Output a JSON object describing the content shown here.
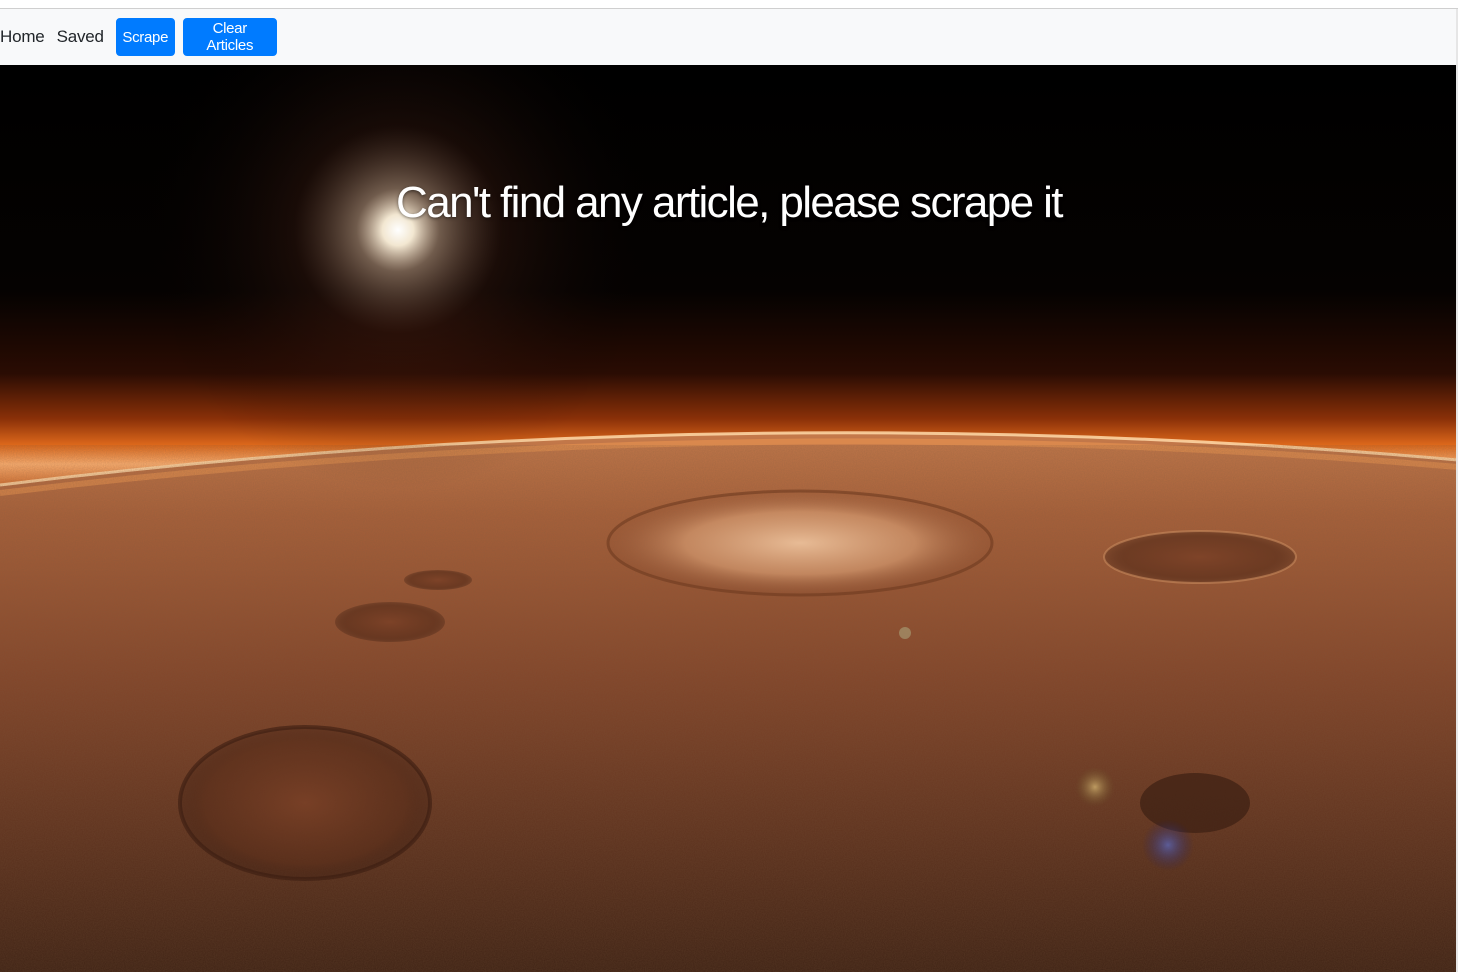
{
  "nav": {
    "links": [
      {
        "label": "Home"
      },
      {
        "label": "Saved"
      }
    ],
    "buttons": {
      "scrape_label": "Scrape",
      "clear_label": "Clear Articles"
    },
    "accent_color": "#007bff"
  },
  "hero": {
    "message": "Can't find any article, please scrape it",
    "background": "mars-horizon-photo"
  }
}
